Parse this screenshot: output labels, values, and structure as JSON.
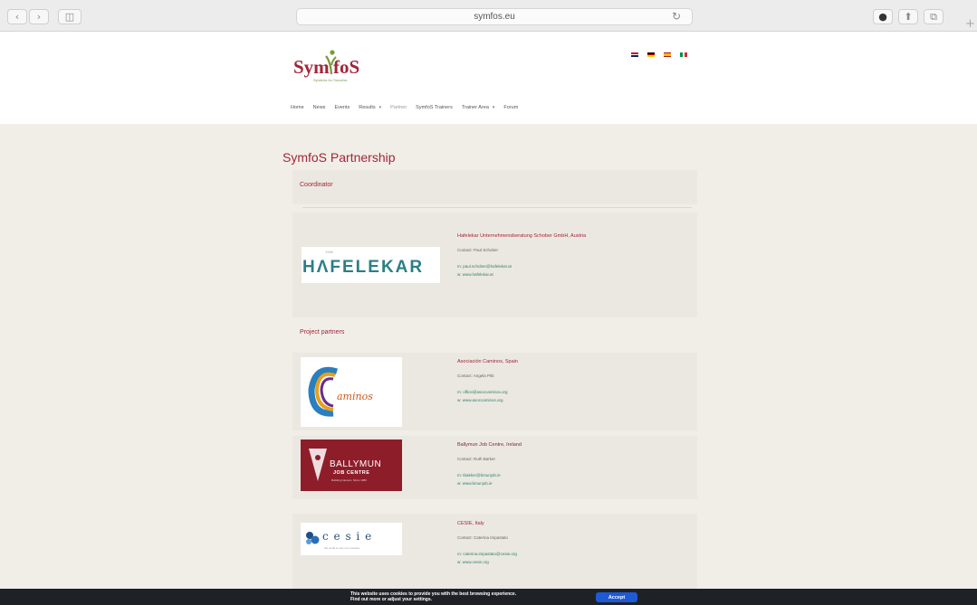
{
  "browser": {
    "url": "symfos.eu",
    "back_glyph": "‹",
    "forward_glyph": "›",
    "sidebar_glyph": "◫",
    "reload_glyph": "↻",
    "download_glyph": "●",
    "share_glyph": "⬆",
    "tabs_glyph": "⧉",
    "newtab_glyph": "+"
  },
  "header": {
    "logo_text_1": "Sym",
    "logo_text_2": "foS",
    "logo_tagline": "Symbols for Success",
    "flags": [
      {
        "lang": "en",
        "colors": [
          "#c8102e",
          "#ffffff",
          "#012169"
        ]
      },
      {
        "lang": "de",
        "colors": [
          "#000000",
          "#dd0000",
          "#ffce00"
        ]
      },
      {
        "lang": "es",
        "colors": [
          "#aa151b",
          "#f1bf00",
          "#aa151b"
        ]
      },
      {
        "lang": "it",
        "colors": [
          "#009246",
          "#ffffff",
          "#ce2b37"
        ]
      }
    ],
    "menu": [
      {
        "label": "Home"
      },
      {
        "label": "News"
      },
      {
        "label": "Events"
      },
      {
        "label": "Results",
        "caret": "▾"
      },
      {
        "label": "Partner"
      },
      {
        "label": "SymfoS Trainers"
      },
      {
        "label": "Trainer Area",
        "caret": "▾"
      },
      {
        "label": "Forum"
      }
    ]
  },
  "main": {
    "page_title": "SymfoS Partnership",
    "coordinator_title": "Coordinator",
    "partners_title": "Project partners",
    "coordinator": {
      "logo_text": "HΛFELEKAR",
      "logo_small": "1988",
      "name": "Hafelekar Unternehmensberatung Schober GmbH, Austria",
      "contact": "Contact: Paul Schober",
      "email": "m: paul.schober@hafelekar.at",
      "web": "w: www.hafelekar.at"
    },
    "partners": [
      {
        "logo_text": "aminos",
        "name": "Asociación Caminos, Spain",
        "contact": "Contact: Angela Pitti",
        "email": "m: office@asoccaminos.org",
        "web": "w: www.asoccaminos.org"
      },
      {
        "logo_text_1": "BALLYMUN",
        "logo_text_2": "JOB CENTRE",
        "logo_text_3": "Building Careers. Since 1986",
        "name": "Ballymun Job Centre, Ireland",
        "contact": "Contact: Ruth Barker",
        "email": "m: tbakker@bmunjob.ie",
        "web": "w: www.bmunjob.ie"
      },
      {
        "logo_text": "c e s i e",
        "logo_small": "the world is only one creature",
        "name": "CESIE, Italy",
        "contact": "Contact: Caterina Impastato",
        "email": "m: caterina.impastato@cesie.org",
        "web": "w: www.cesie.org"
      }
    ]
  },
  "cookie": {
    "line1": "This website uses cookies to provide you with the best browsing experience.",
    "line2": "Find out more or adjust your settings.",
    "accept": "Accept"
  }
}
